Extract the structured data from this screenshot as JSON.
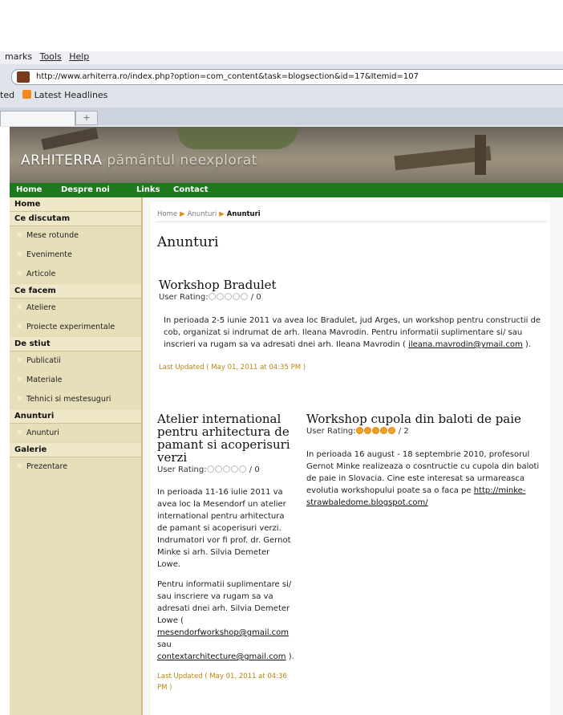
{
  "browser": {
    "menu": {
      "bookmarks": "marks",
      "tools": "Tools",
      "help": "Help"
    },
    "url": "http://www.arhiterra.ro/index.php?option=com_content&task=blogsection&id=17&Itemid=107",
    "bookmarks_bar": {
      "left": "ted",
      "latest": "Latest Headlines"
    },
    "new_tab": "+"
  },
  "site": {
    "title_main": "ARHITERRA ",
    "title_sub": "pământul neexplorat"
  },
  "topnav": [
    "Home",
    "Despre noi",
    "Links",
    "Contact"
  ],
  "sidebar": {
    "home": "Home",
    "sections": [
      {
        "title": "Ce discutam",
        "items": [
          "Mese rotunde",
          "Evenimente",
          "Articole"
        ]
      },
      {
        "title": "Ce facem",
        "items": [
          "Ateliere",
          "Proiecte experimentale"
        ]
      },
      {
        "title": "De stiut",
        "items": [
          "Publicatii",
          "Materiale",
          "Tehnici si mestesuguri"
        ]
      },
      {
        "title": "Anunturi",
        "items": [
          "Anunturi"
        ]
      },
      {
        "title": "Galerie",
        "items": [
          "Prezentare"
        ]
      }
    ]
  },
  "breadcrumb": {
    "home": "Home",
    "level1": "Anunturi",
    "current": "Anunturi"
  },
  "page_title": "Anunturi",
  "articles": {
    "a1": {
      "title": "Workshop Bradulet",
      "rating_label": "User Rating:",
      "rating_value": 0,
      "rating_suffix": " / 0",
      "body": "In perioada 2-5 iunie 2011 va avea loc Bradulet, jud Arges, un workshop pentru constructii de cob, organizat si indrumat de arh. Ileana Mavrodin. Pentru informatii suplimentare si/ sau inscrieri va rugam sa va adresati dnei arh. Ileana Mavrodin ( ",
      "email": "ileana.mavrodin@ymail.com",
      "body_end": " ).",
      "updated": "Last Updated ( May 01, 2011 at 04:35 PM )"
    },
    "a2": {
      "title": "Atelier international pentru arhitectura de pamant si acoperisuri verzi",
      "rating_label": "User Rating:",
      "rating_value": 0,
      "rating_suffix": " / 0",
      "p1": "In perioada 11-16 iulie 2011 va avea loc la Mesendorf un atelier international pentru arhitectura de pamant si acoperisuri verzi. Indrumatori vor fi prof. dr. Gernot Minke si arh. Silvia Demeter Lowe.",
      "p2": "Pentru informatii suplimentare si/ sau inscriere va rugam sa va adresati dnei arh. Silvia Demeter Lowe ( ",
      "email1": "mesendorfworkshop@gmail.com",
      "sau": " sau ",
      "email2": "contextarchitecture@gmail.com",
      "p2_end": " ).",
      "updated": "Last Updated ( May 01, 2011 at 04:36 PM )"
    },
    "a3": {
      "title": "Workshop cupola din baloti de paie",
      "rating_label": "User Rating:",
      "rating_value": 5,
      "rating_suffix": " / 2",
      "body": "In perioada 16 august - 18 septembrie 2010, profesorul Gernot Minke realizeaza o cosntructie cu cupola din baloti de paie in Slovacia. Cine este interesat sa urmareasca evolutia workshopului poate sa o faca pe ",
      "link": "http://minke-strawbaledome.blogspot.com/"
    }
  },
  "colors": {
    "nav_green": "#1f7a1f",
    "sidebar_bg": "#e7dfb9",
    "accent_orange": "#e08a1c",
    "updated_text": "#b8860b"
  }
}
